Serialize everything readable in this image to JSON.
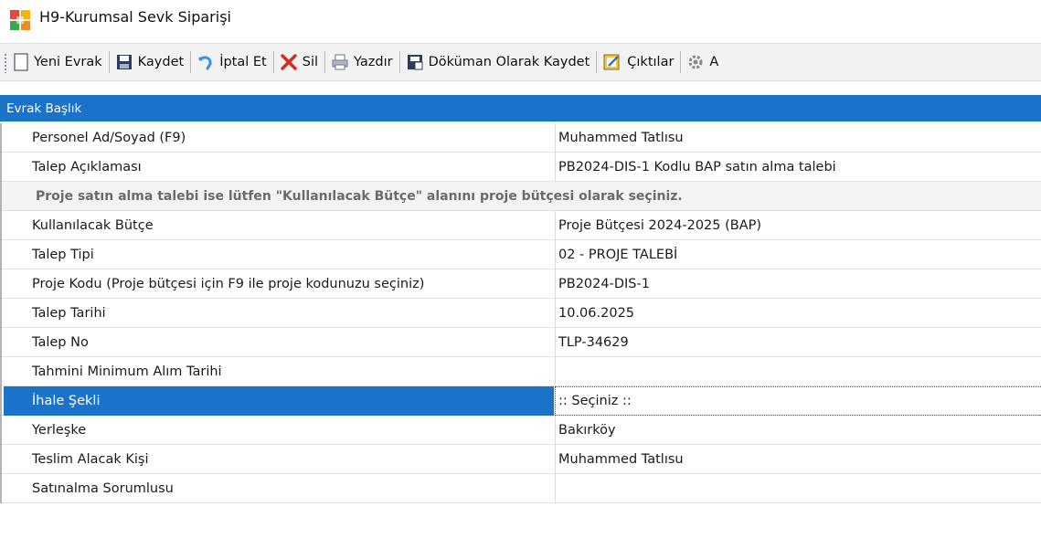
{
  "window": {
    "title": "H9-Kurumsal Sevk Siparişi"
  },
  "toolbar": {
    "new_label": "Yeni Evrak",
    "save_label": "Kaydet",
    "cancel_label": "İptal Et",
    "delete_label": "Sil",
    "print_label": "Yazdır",
    "save_doc_label": "Döküman Olarak Kaydet",
    "outputs_label": "Çıktılar",
    "more_label": "A"
  },
  "section": {
    "title": "Evrak Başlık"
  },
  "fields": {
    "personnel": {
      "label": "Personel Ad/Soyad (F9)",
      "value": "Muhammed Tatlısu"
    },
    "description": {
      "label": "Talep Açıklaması",
      "value": "PB2024-DIS-1 Kodlu BAP satın alma talebi"
    },
    "notice": "Proje satın alma talebi ise lütfen \"Kullanılacak Bütçe\" alanını proje bütçesi olarak seçiniz.",
    "budget": {
      "label": "Kullanılacak Bütçe",
      "value": "Proje Bütçesi 2024-2025 (BAP)"
    },
    "request_type": {
      "label": "Talep Tipi",
      "value": "02 - PROJE TALEBİ"
    },
    "project_code": {
      "label": "Proje Kodu (Proje bütçesi için F9 ile proje kodunuzu seçiniz)",
      "value": "PB2024-DIS-1"
    },
    "request_date": {
      "label": "Talep Tarihi",
      "value": "10.06.2025"
    },
    "request_no": {
      "label": "Talep No",
      "value": "TLP-34629"
    },
    "min_purchase_date": {
      "label": "Tahmini Minimum Alım Tarihi",
      "value": ""
    },
    "tender_type": {
      "label": "İhale Şekli",
      "value": ":: Seçiniz ::"
    },
    "campus": {
      "label": "Yerleşke",
      "value": "Bakırköy"
    },
    "receiver": {
      "label": "Teslim Alacak Kişi",
      "value": "Muhammed Tatlısu"
    },
    "purchasing_officer": {
      "label": "Satınalma Sorumlusu",
      "value": ""
    }
  },
  "colors": {
    "accent": "#1a72c9",
    "toolbar_bg": "#f2f2f2",
    "notice_text": "#6b6b6b"
  }
}
